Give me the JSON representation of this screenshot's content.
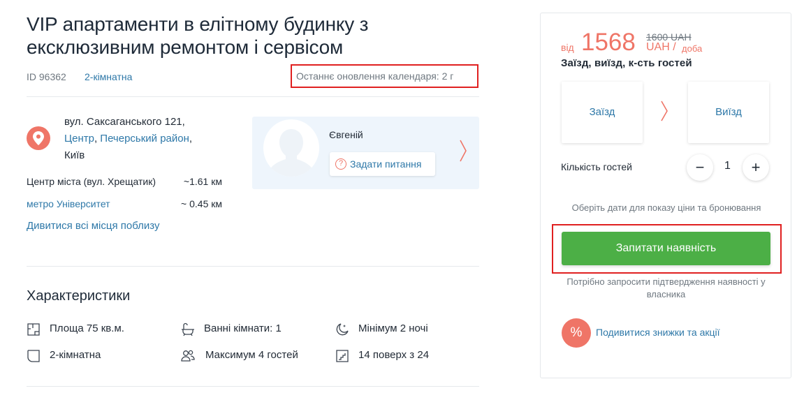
{
  "listing": {
    "title": "VIP апартаменти в елітному будинку з ексклюзивним ремонтом і сервісом",
    "id_text": "ID 96362",
    "rooms_link": "2-кімнатна",
    "calendar_updated": "Останнє оновлення календаря: 2 г"
  },
  "location": {
    "street": "вул. Саксаганського 121,",
    "district_link": "Центр",
    "district_sep": ", ",
    "area_link": "Печерський район",
    "area_sep": ",",
    "city": "Київ",
    "distances": [
      {
        "label": "Центр міста (вул. Хрещатик)",
        "value": "~1.61 км",
        "is_link": false
      },
      {
        "label": "метро Університет",
        "value": "~ 0.45 км",
        "is_link": true
      }
    ],
    "nearby_link": "Дивитися всі місця поблизу"
  },
  "host": {
    "name": "Євгеній",
    "ask_button": "Задати питання",
    "ask_icon": "?"
  },
  "features": {
    "title": "Характеристики",
    "items": [
      {
        "icon": "area-icon",
        "text": "Площа 75 кв.м."
      },
      {
        "icon": "bathtub-icon",
        "text": "Ванні кімнати: 1"
      },
      {
        "icon": "moon-icon",
        "text": "Мінімум 2 ночі"
      },
      {
        "icon": "rooms-icon",
        "text": "2-кімнатна"
      },
      {
        "icon": "guests-icon",
        "text": "Максимум 4 гостей"
      },
      {
        "icon": "stairs-icon",
        "text": "14 поверх з 24"
      }
    ]
  },
  "booking": {
    "price_from": "від",
    "price": "1568",
    "price_old": "1600 UAH",
    "currency": "UAH /",
    "per": "доба",
    "dates_label": "Заїзд, виїзд, к-сть гостей",
    "checkin": "Заїзд",
    "checkout": "Виїзд",
    "guests_label": "Кількість гостей",
    "minus": "−",
    "plus": "+",
    "guests_value": "1",
    "hint": "Оберіть дати для показу ціни та бронювання",
    "request_button": "Запитати наявність",
    "request_note": "Потрібно запросити підтвердження наявності у власника",
    "discount_icon": "%",
    "discount_link": "Подивитися знижки та акції"
  },
  "colors": {
    "accent": "#ef7567",
    "link": "#2e78a8",
    "primary_button": "#4caf46",
    "highlight_frame": "#e02020",
    "host_card_bg": "#eef5fc"
  }
}
